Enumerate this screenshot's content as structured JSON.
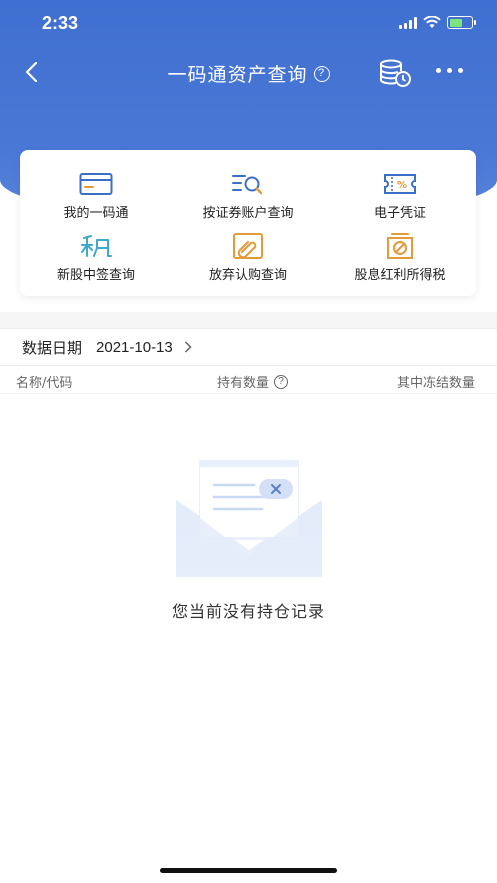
{
  "status_bar": {
    "time": "2:33"
  },
  "nav": {
    "title": "一码通资产查询",
    "help_symbol": "?"
  },
  "menu": {
    "items": [
      {
        "label": "我的一码通",
        "icon": "card-icon"
      },
      {
        "label": "按证券账户查询",
        "icon": "list-search-icon"
      },
      {
        "label": "电子凭证",
        "icon": "voucher-icon"
      },
      {
        "label": "新股中签查询",
        "icon": "ipo-lottery-icon"
      },
      {
        "label": "放弃认购查询",
        "icon": "abandon-subscription-icon"
      },
      {
        "label": "股息红利所得税",
        "icon": "dividend-tax-icon"
      }
    ]
  },
  "data_date": {
    "label": "数据日期",
    "value": "2021-10-13"
  },
  "columns": {
    "name": "名称/代码",
    "holding": "持有数量",
    "frozen": "其中冻结数量"
  },
  "empty_state": {
    "message": "您当前没有持仓记录"
  },
  "colors": {
    "header_blue": "#4a78d6",
    "icon_blue": "#3a6fc9",
    "icon_orange": "#e39a3b",
    "icon_teal": "#3fa9c9"
  }
}
